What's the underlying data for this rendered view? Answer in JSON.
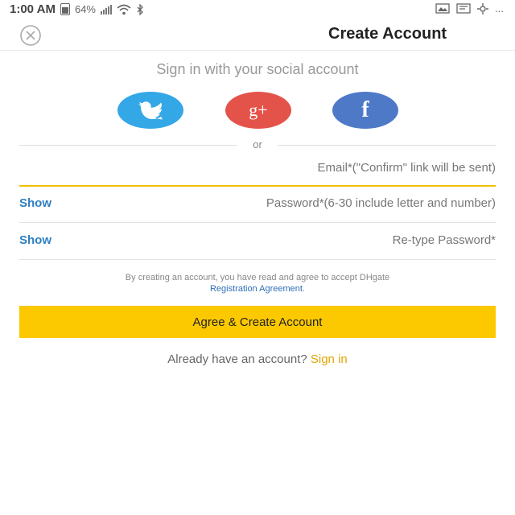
{
  "status_bar": {
    "time": "1:00 AM",
    "battery_percent": "64%",
    "icons": [
      "battery-icon",
      "signal-icon",
      "wifi-icon",
      "bluetooth-icon",
      "image-icon",
      "notification-icon",
      "more-icon"
    ],
    "more": "..."
  },
  "header": {
    "title": "Create Account",
    "close_icon": "close-circle-icon"
  },
  "social": {
    "heading": "Sign in with your social account",
    "buttons": [
      {
        "name": "twitter",
        "icon": "twitter-bird-icon",
        "color": "#34a7e6"
      },
      {
        "name": "google-plus",
        "icon": "google-plus-icon",
        "label": "g+",
        "color": "#e4534a"
      },
      {
        "name": "facebook",
        "icon": "facebook-icon",
        "label": "f",
        "color": "#4e79c7"
      }
    ],
    "or_label": "or"
  },
  "form": {
    "email_placeholder": "Email*(\"Confirm\" link will be sent)",
    "password_placeholder": "Password*(6-30 include letter and number)",
    "password_show": "Show",
    "retype_placeholder": "Re-type Password*",
    "retype_show": "Show"
  },
  "terms": {
    "text": "By creating an account, you have read and agree to accept DHgate",
    "link": "Registration Agreement",
    "suffix": "."
  },
  "actions": {
    "create_button": "Agree & Create Account",
    "already_text": "Already have an account?",
    "signin_link": "Sign in"
  },
  "colors": {
    "accent": "#fcc800",
    "link": "#2f7fc1",
    "signin": "#e0a400"
  }
}
